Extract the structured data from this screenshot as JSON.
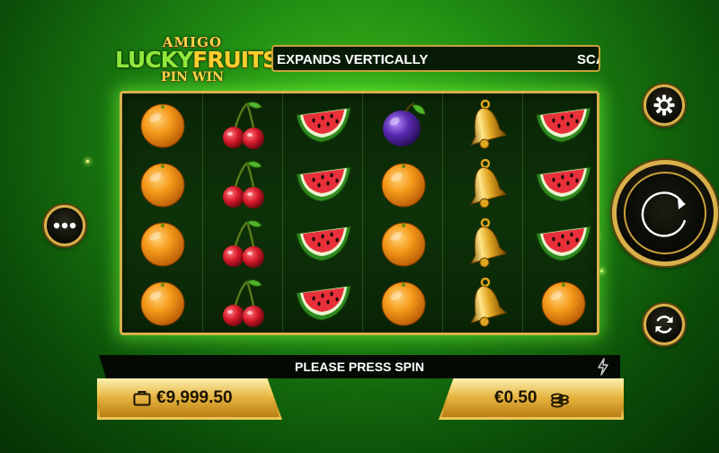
{
  "game": {
    "logo": {
      "line1": "AMIGO",
      "line2a": "LUCKY",
      "line2b": "FRUITS",
      "line3": "PIN WIN"
    },
    "ticker": {
      "text": "EXPANDS VERTICALLY",
      "text_next": "SCA"
    },
    "message": "PLEASE PRESS SPIN",
    "balance": {
      "value": "€9,999.50",
      "icon": "wallet-icon"
    },
    "bet": {
      "value": "€0.50",
      "icon": "coins-icon"
    },
    "buttons": {
      "menu": "dots-menu-icon",
      "settings": "gear-icon",
      "spin": "spin-arrow-icon",
      "autoplay": "autoplay-icon"
    },
    "grid": {
      "columns": 6,
      "rows": 4,
      "reels": [
        [
          "orange",
          "orange",
          "orange",
          "orange"
        ],
        [
          "cherry",
          "cherry",
          "cherry",
          "cherry"
        ],
        [
          "watermelon",
          "watermelon",
          "watermelon",
          "watermelon"
        ],
        [
          "plum",
          "orange",
          "orange",
          "orange"
        ],
        [
          "bell",
          "bell",
          "bell",
          "bell"
        ],
        [
          "watermelon",
          "watermelon",
          "watermelon",
          "orange"
        ]
      ]
    },
    "colors": {
      "gold": "#d6b24a",
      "bg_green": "#1f8a12",
      "reel_bg": "#0a2406"
    }
  }
}
